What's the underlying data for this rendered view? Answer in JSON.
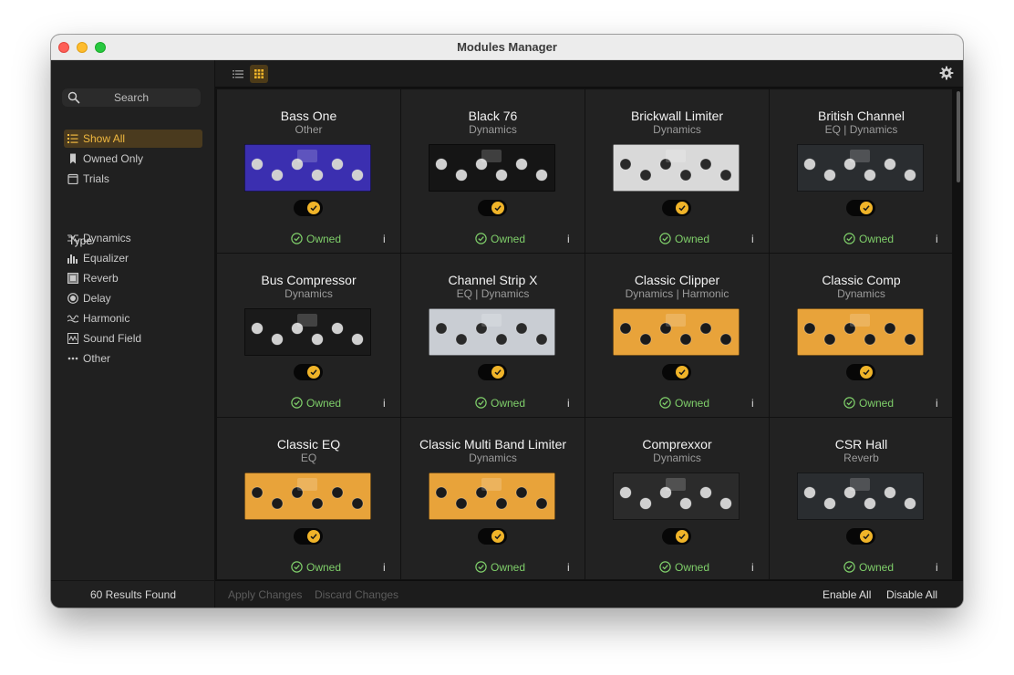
{
  "window": {
    "title": "Modules Manager"
  },
  "sidebar": {
    "search_placeholder": "Search",
    "filters": [
      {
        "label": "Show All",
        "icon": "list-icon",
        "active": true
      },
      {
        "label": "Owned Only",
        "icon": "bookmark-icon",
        "active": false
      },
      {
        "label": "Trials",
        "icon": "calendar-icon",
        "active": false
      }
    ],
    "type_heading": "Type",
    "types": [
      {
        "label": "Dynamics",
        "icon": "dynamics-icon"
      },
      {
        "label": "Equalizer",
        "icon": "equalizer-icon"
      },
      {
        "label": "Reverb",
        "icon": "reverb-icon"
      },
      {
        "label": "Delay",
        "icon": "delay-icon"
      },
      {
        "label": "Harmonic",
        "icon": "harmonic-icon"
      },
      {
        "label": "Sound Field",
        "icon": "sound-field-icon"
      },
      {
        "label": "Other",
        "icon": "more-icon"
      }
    ],
    "results": "60 Results Found"
  },
  "toolbar": {
    "list_view_icon": "list-view-icon",
    "grid_view_icon": "grid-view-icon",
    "settings_icon": "gear-icon"
  },
  "modules": [
    {
      "name": "Bass One",
      "category": "Other",
      "status": "Owned",
      "enabled": true,
      "accent": "#3b2fb0"
    },
    {
      "name": "Black 76",
      "category": "Dynamics",
      "status": "Owned",
      "enabled": true,
      "accent": "#151515"
    },
    {
      "name": "Brickwall Limiter",
      "category": "Dynamics",
      "status": "Owned",
      "enabled": true,
      "accent": "#d9d9d9"
    },
    {
      "name": "British Channel",
      "category": "EQ | Dynamics",
      "status": "Owned",
      "enabled": true,
      "accent": "#2a2d30"
    },
    {
      "name": "Bus Compressor",
      "category": "Dynamics",
      "status": "Owned",
      "enabled": true,
      "accent": "#1a1a1a"
    },
    {
      "name": "Channel Strip X",
      "category": "EQ | Dynamics",
      "status": "Owned",
      "enabled": true,
      "accent": "#c9cdd3"
    },
    {
      "name": "Classic Clipper",
      "category": "Dynamics | Harmonic",
      "status": "Owned",
      "enabled": true,
      "accent": "#e8a33a"
    },
    {
      "name": "Classic Comp",
      "category": "Dynamics",
      "status": "Owned",
      "enabled": true,
      "accent": "#e8a33a"
    },
    {
      "name": "Classic EQ",
      "category": "EQ",
      "status": "Owned",
      "enabled": true,
      "accent": "#e8a33a"
    },
    {
      "name": "Classic Multi Band Limiter",
      "category": "Dynamics",
      "status": "Owned",
      "enabled": true,
      "accent": "#e8a33a"
    },
    {
      "name": "Comprexxor",
      "category": "Dynamics",
      "status": "Owned",
      "enabled": true,
      "accent": "#2b2b2b"
    },
    {
      "name": "CSR Hall",
      "category": "Reverb",
      "status": "Owned",
      "enabled": true,
      "accent": "#2a2d30"
    }
  ],
  "info_label": "i",
  "footer": {
    "apply": "Apply Changes",
    "discard": "Discard Changes",
    "enable_all": "Enable All",
    "disable_all": "Disable All"
  }
}
